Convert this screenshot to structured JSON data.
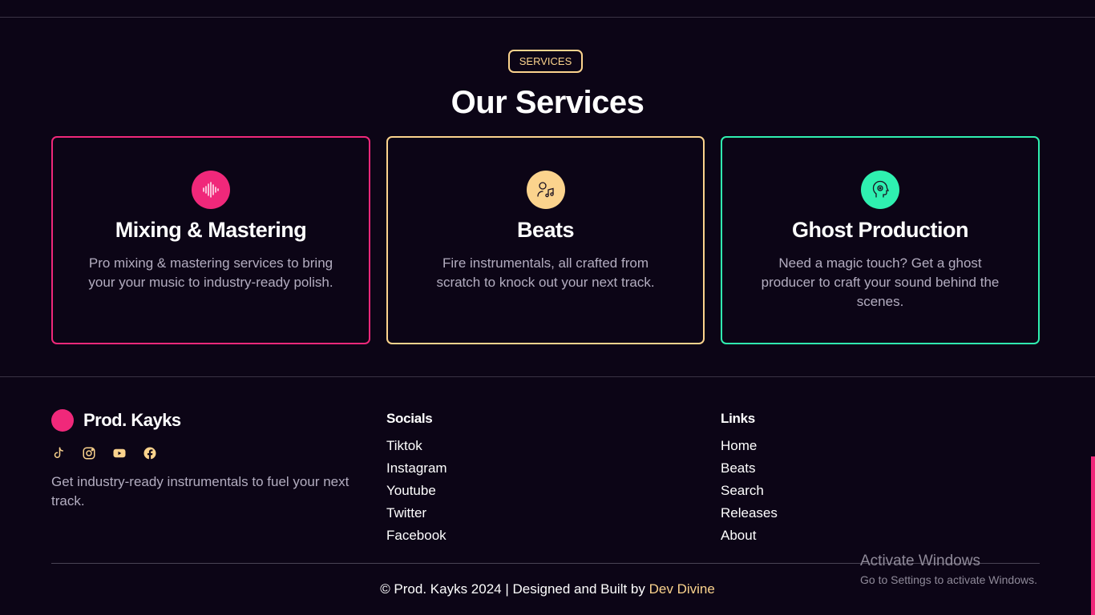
{
  "services": {
    "badge": "SERVICES",
    "title": "Our Services",
    "cards": [
      {
        "title": "Mixing & Mastering",
        "description": "Pro mixing & mastering services to bring your your music to industry-ready polish.",
        "icon": "sound-wave-icon",
        "color": "#f0287a"
      },
      {
        "title": "Beats",
        "description": "Fire instrumentals, all crafted from scratch to knock out your next track.",
        "icon": "music-user-icon",
        "color": "#fbd38d"
      },
      {
        "title": "Ghost Production",
        "description": "Need a magic touch? Get a ghost producer to craft your sound behind the scenes.",
        "icon": "ghost-head-icon",
        "color": "#2ff0b0"
      }
    ]
  },
  "footer": {
    "brand": "Prod. Kayks",
    "brand_color": "#f0287a",
    "social_icons": [
      "tiktok-icon",
      "instagram-icon",
      "youtube-icon",
      "facebook-icon"
    ],
    "tagline": "Get industry-ready instrumentals to fuel your next track.",
    "socials": {
      "heading": "Socials",
      "items": [
        "Tiktok",
        "Instagram",
        "Youtube",
        "Twitter",
        "Facebook"
      ]
    },
    "links": {
      "heading": "Links",
      "items": [
        "Home",
        "Beats",
        "Search",
        "Releases",
        "About"
      ]
    },
    "copyright_prefix": "© Prod. Kayks 2024 | Designed and Built by",
    "copyright_author": "Dev Divine",
    "accent_color": "#fbd38d"
  },
  "os_overlay": {
    "title": "Activate Windows",
    "subtitle": "Go to Settings to activate Windows."
  }
}
